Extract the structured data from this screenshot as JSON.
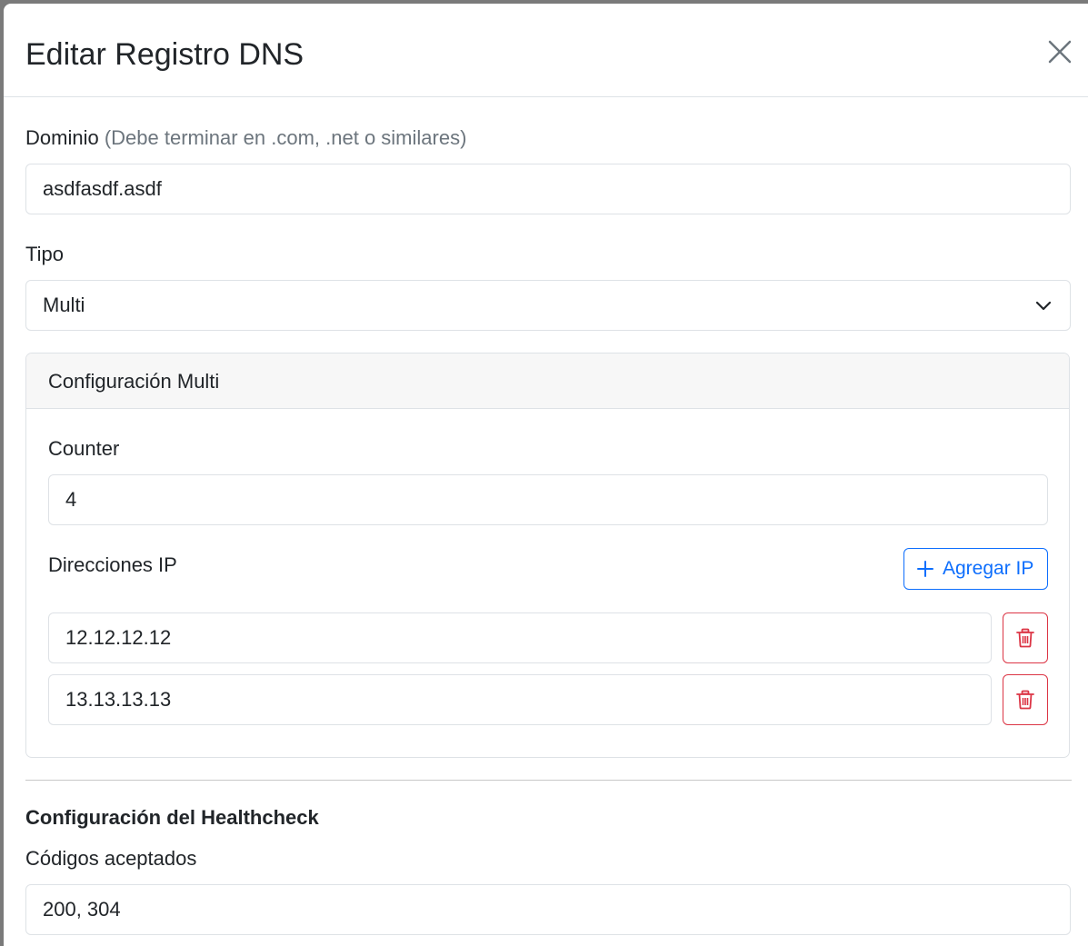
{
  "modal": {
    "title": "Editar Registro DNS"
  },
  "form": {
    "domain": {
      "label": "Dominio",
      "hint": "(Debe terminar en .com, .net o similares)",
      "value": "asdfasdf.asdf"
    },
    "type": {
      "label": "Tipo",
      "value": "Multi"
    },
    "multi_config": {
      "title": "Configuración Multi",
      "counter_label": "Counter",
      "counter_value": "4",
      "ips_label": "Direcciones IP",
      "add_ip_label": "Agregar IP",
      "ips": [
        "12.12.12.12",
        "13.13.13.13"
      ]
    },
    "healthcheck": {
      "title": "Configuración del Healthcheck",
      "codes_label": "Códigos aceptados",
      "codes_value": "200, 304"
    }
  },
  "colors": {
    "primary": "#0d6efd",
    "danger": "#dc3545",
    "border": "#dee2e6",
    "hint": "#6c757d"
  },
  "icons": [
    "close-icon",
    "chevron-down-icon",
    "plus-icon",
    "trash-icon"
  ]
}
